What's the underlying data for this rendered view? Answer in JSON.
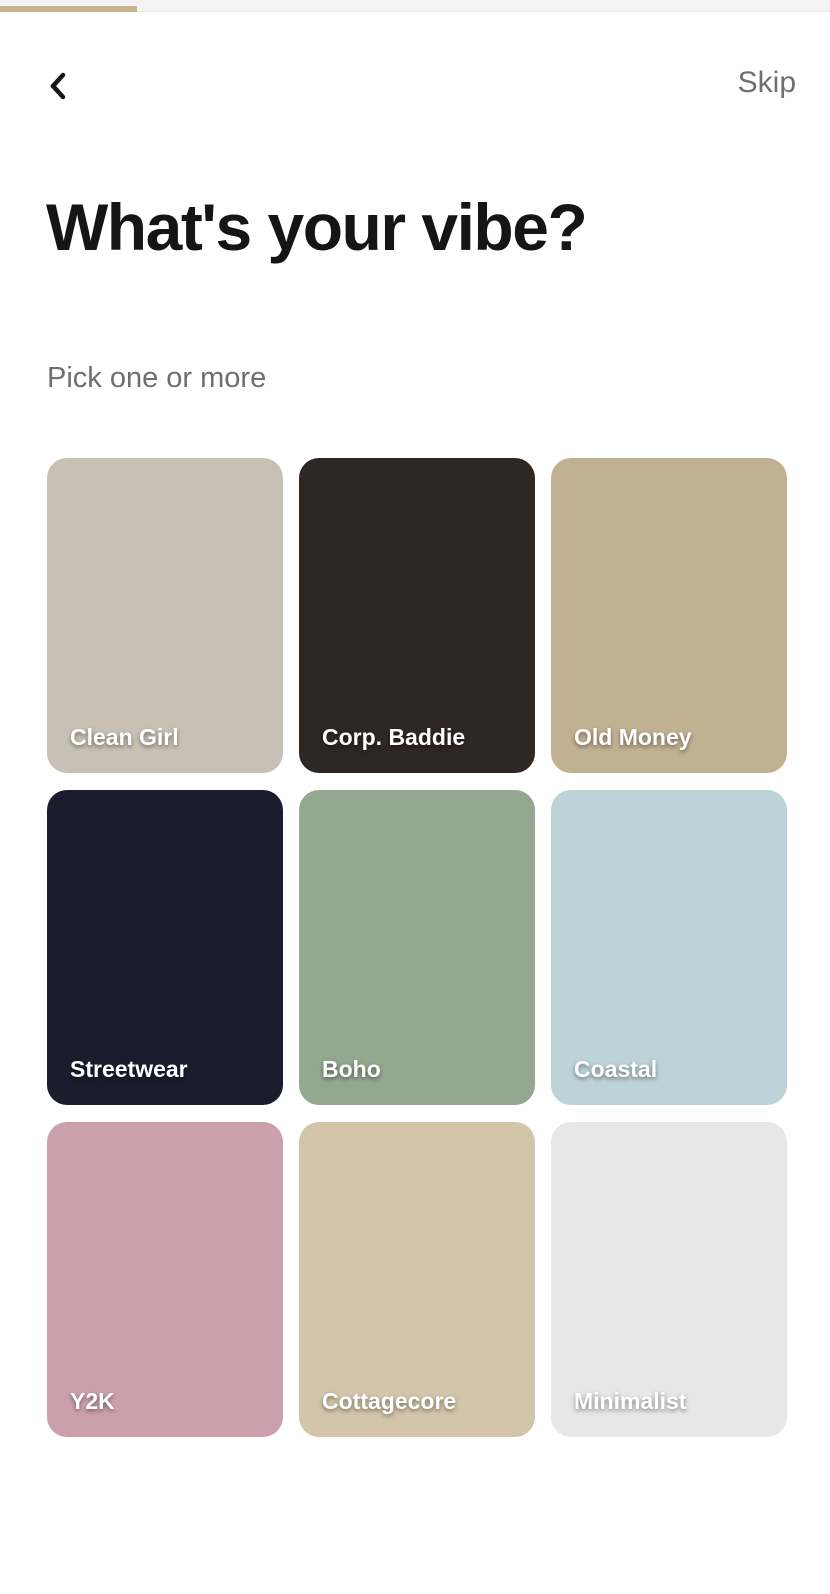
{
  "progress": {
    "fraction": 0.165,
    "color": "#c6b38c"
  },
  "header": {
    "back_icon": "chevron-left-icon",
    "skip_label": "Skip"
  },
  "title": "What's your vibe?",
  "subtitle": "Pick one or more",
  "vibes": [
    {
      "label": "Clean Girl",
      "color": "#c8c0b4"
    },
    {
      "label": "Corp. Baddie",
      "color": "#2f2724"
    },
    {
      "label": "Old Money",
      "color": "#c1b193"
    },
    {
      "label": "Streetwear",
      "color": "#1b1c2d"
    },
    {
      "label": "Boho",
      "color": "#94a890"
    },
    {
      "label": "Coastal",
      "color": "#bdd3d8"
    },
    {
      "label": "Y2K",
      "color": "#cba0ad"
    },
    {
      "label": "Cottagecore",
      "color": "#d3c5a9"
    },
    {
      "label": "Minimalist",
      "color": "#e7e7e7"
    }
  ]
}
